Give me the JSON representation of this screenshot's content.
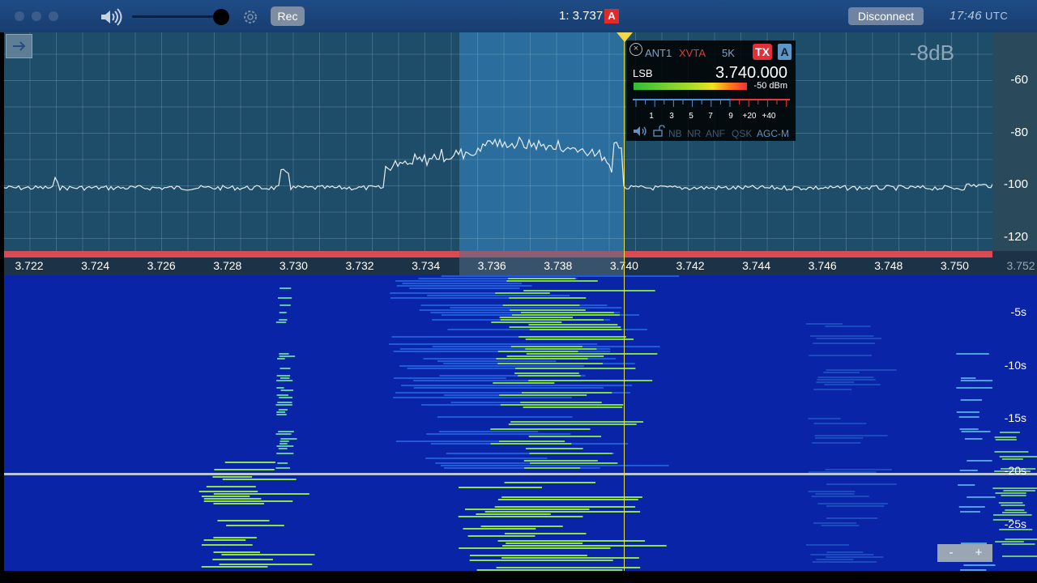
{
  "titlebar": {
    "rec_label": "Rec",
    "slice_freq": "1: 3.737",
    "slice_badge": "A",
    "disconnect_label": "Disconnect",
    "clock_time": "17:46",
    "clock_zone": "UTC"
  },
  "spectrum": {
    "db_offset": "-8dB",
    "db_ticks": [
      "-60",
      "-80",
      "-100",
      "-120"
    ],
    "freq_labels": [
      "3.722",
      "3.724",
      "3.726",
      "3.728",
      "3.730",
      "3.732",
      "3.734",
      "3.736",
      "3.738",
      "3.740",
      "3.742",
      "3.744",
      "3.746",
      "3.748",
      "3.750",
      "3.752"
    ]
  },
  "vfo": {
    "antenna": "ANT1",
    "xvtr": "XVTA",
    "bandwidth": "5K",
    "tx_label": "TX",
    "slice_letter": "A",
    "mode": "LSB",
    "frequency": "3.740.000",
    "signal_dbm": "-50 dBm",
    "smeter_labels": [
      "1",
      "3",
      "5",
      "7",
      "9",
      "+20",
      "+40"
    ],
    "options": [
      "NB",
      "NR",
      "ANF",
      "QSK",
      "AGC-M"
    ]
  },
  "waterfall": {
    "time_labels": [
      "-5s",
      "-10s",
      "-15s",
      "-20s",
      "-25s"
    ],
    "zoom_minus": "-",
    "zoom_plus": "+"
  },
  "colors": {
    "titlebar": "#1f4c86",
    "spectrum_bg": "#1e4d6a",
    "filter_band": "#3c96dc",
    "marker": "#f0d84a",
    "waterfall_bg": "#0a24a8",
    "waterfall_signal": "#9be04a"
  }
}
